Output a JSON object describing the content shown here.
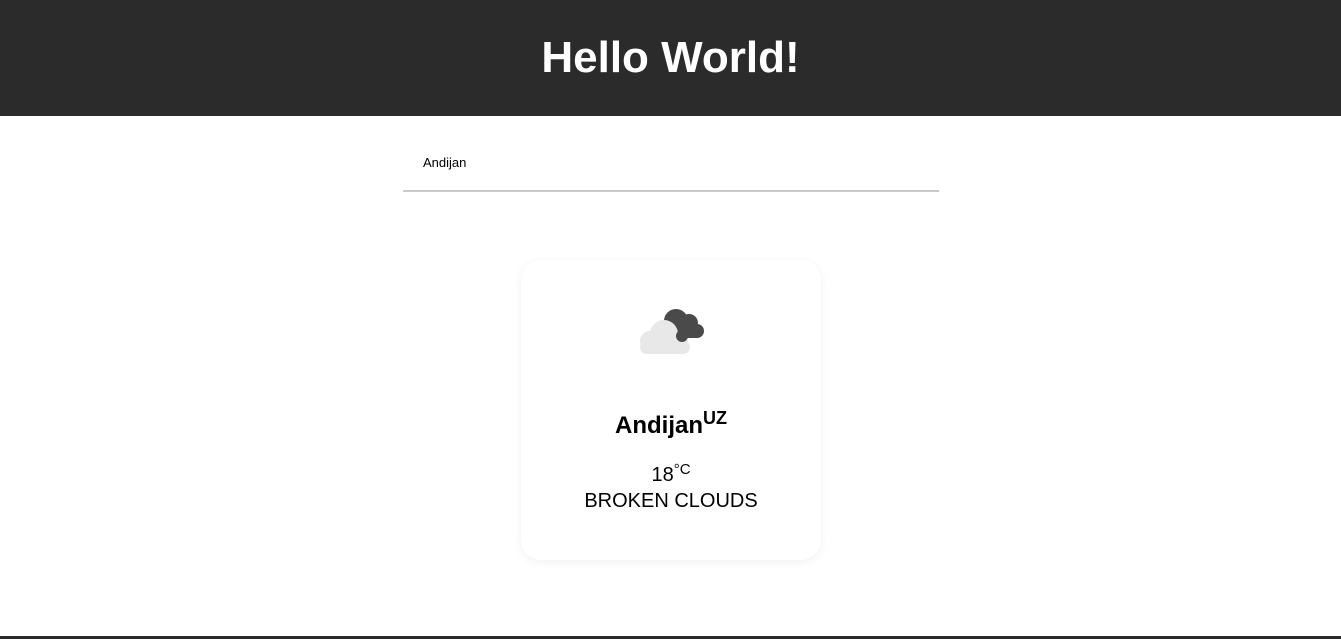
{
  "header": {
    "title": "Hello World!"
  },
  "search": {
    "value": "Andijan",
    "placeholder": ""
  },
  "weather_card": {
    "icon": "broken-clouds-icon",
    "city": "Andijan",
    "country": "UZ",
    "temperature": "18",
    "unit": "°C",
    "description": "BROKEN CLOUDS"
  },
  "colors": {
    "header_bg": "#2c2b2c",
    "cloud_dark": "#4a4a4a",
    "cloud_light": "#e8e8e8"
  }
}
